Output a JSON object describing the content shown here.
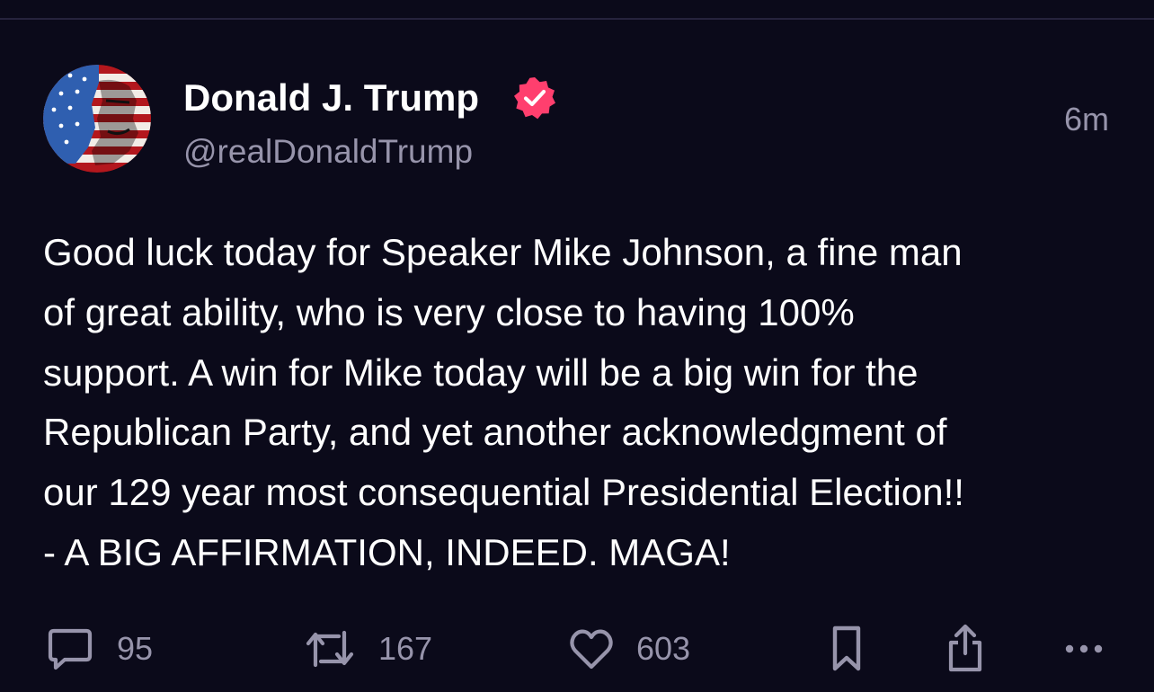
{
  "post": {
    "author": {
      "display_name": "Donald J. Trump",
      "handle": "@realDonaldTrump",
      "verified": true,
      "avatar_icon": "flag-portrait-avatar"
    },
    "timestamp": "6m",
    "body": "Good luck today for Speaker Mike Johnson, a fine man\nof great ability, who is very close to having 100%\nsupport. A win for Mike today will be a big win for the\nRepublican Party, and yet another acknowledgment of\nour 129 year most consequential Presidential Election!!\n- A BIG AFFIRMATION, INDEED. MAGA!",
    "actions": {
      "replies": "95",
      "reposts": "167",
      "likes": "603"
    }
  },
  "icons": {
    "reply": "reply-icon",
    "repost": "repost-icon",
    "like": "heart-icon",
    "bookmark": "bookmark-icon",
    "share": "share-icon",
    "more": "more-icon",
    "verified": "verified-badge-icon"
  },
  "colors": {
    "background": "#0b0a1a",
    "text_primary": "#ffffff",
    "text_secondary": "#9794ab",
    "verified_badge": "#ff3f6e",
    "divider": "#26233d"
  }
}
